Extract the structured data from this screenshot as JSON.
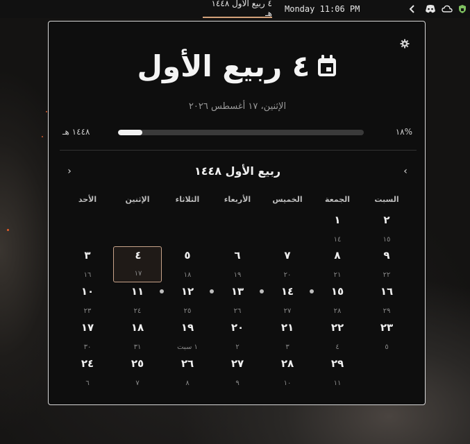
{
  "topbar": {
    "hijri_date": "٤ ربيع الأول ١٤٤٨ هـ",
    "clock": "Monday 11:06 PM",
    "tray_icons": [
      "chevron-left-icon",
      "discord-icon",
      "cloud-icon",
      "shield-icon"
    ]
  },
  "popup": {
    "title": "٤ ربيع الأول",
    "gregorian_date": "الإثنين، ١٧ أغسطس ٢٠٢٦",
    "year_label": "١٤٤٨ هـ",
    "progress_percent_label": "١٨%",
    "progress_fraction": 0.1,
    "month_title": "ربيع الأول ١٤٤٨",
    "weekdays": [
      "السبت",
      "الجمعة",
      "الخميس",
      "الأربعاء",
      "الثلاثاء",
      "الإثنين",
      "الأحد"
    ],
    "weeks": [
      [
        {
          "h": "٢",
          "g": "١٥"
        },
        {
          "h": "١",
          "g": "١٤"
        },
        null,
        null,
        null,
        null,
        null
      ],
      [
        {
          "h": "٩",
          "g": "٢٢"
        },
        {
          "h": "٨",
          "g": "٢١"
        },
        {
          "h": "٧",
          "g": "٢٠"
        },
        {
          "h": "٦",
          "g": "١٩"
        },
        {
          "h": "٥",
          "g": "١٨"
        },
        {
          "h": "٤",
          "g": "١٧",
          "today": true
        },
        {
          "h": "٣",
          "g": "١٦"
        }
      ],
      [
        {
          "h": "١٦",
          "g": "٢٩"
        },
        {
          "h": "١٥",
          "g": "٢٨",
          "event": true
        },
        {
          "h": "١٤",
          "g": "٢٧",
          "event": true
        },
        {
          "h": "١٣",
          "g": "٢٦",
          "event": true
        },
        {
          "h": "١٢",
          "g": "٢٥",
          "event": true
        },
        {
          "h": "١١",
          "g": "٢٤"
        },
        {
          "h": "١٠",
          "g": "٢٣"
        }
      ],
      [
        {
          "h": "٢٣",
          "g": "٥"
        },
        {
          "h": "٢٢",
          "g": "٤"
        },
        {
          "h": "٢١",
          "g": "٣"
        },
        {
          "h": "٢٠",
          "g": "٢"
        },
        {
          "h": "١٩",
          "g": "١ سبت"
        },
        {
          "h": "١٨",
          "g": "٣١"
        },
        {
          "h": "١٧",
          "g": "٣٠"
        }
      ],
      [
        null,
        {
          "h": "٢٩",
          "g": "١١"
        },
        {
          "h": "٢٨",
          "g": "١٠"
        },
        {
          "h": "٢٧",
          "g": "٩"
        },
        {
          "h": "٢٦",
          "g": "٨"
        },
        {
          "h": "٢٥",
          "g": "٧"
        },
        {
          "h": "٢٤",
          "g": "٦"
        }
      ]
    ]
  }
}
